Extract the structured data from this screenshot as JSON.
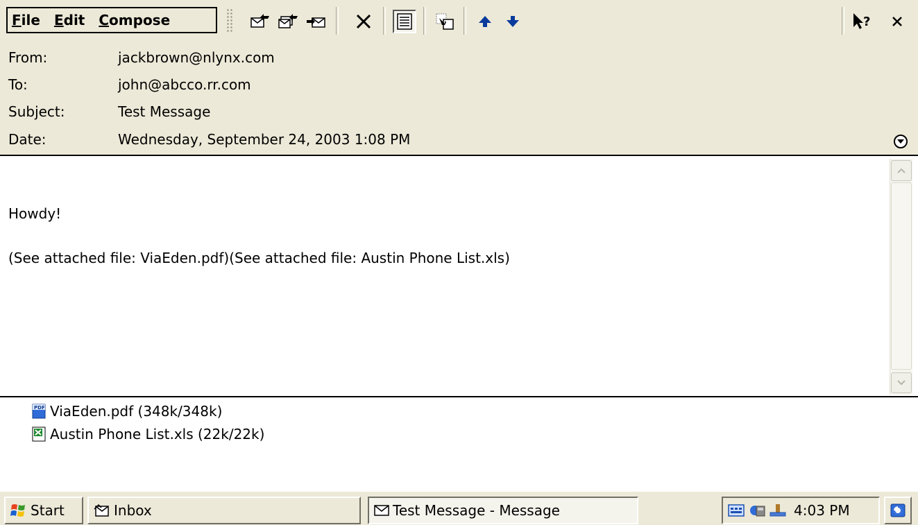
{
  "menu": {
    "file": {
      "mnemonic": "F",
      "rest": "ile"
    },
    "edit": {
      "mnemonic": "E",
      "rest": "dit"
    },
    "compose": {
      "mnemonic": "C",
      "rest": "ompose"
    }
  },
  "toolbar": {
    "icons": [
      "reply-icon",
      "reply-all-icon",
      "forward-icon",
      "delete-icon",
      "full-screen-icon",
      "move-icon",
      "previous-icon",
      "next-icon",
      "help-icon",
      "close-icon"
    ]
  },
  "header": {
    "from": {
      "label": "From:",
      "value": "jackbrown@nlynx.com"
    },
    "to": {
      "label": "To:",
      "value": "john@abcco.rr.com"
    },
    "subject": {
      "label": "Subject:",
      "value": "Test Message"
    },
    "date": {
      "label": "Date:",
      "value": "Wednesday, September 24, 2003 1:08 PM"
    }
  },
  "body": {
    "greeting": "Howdy!",
    "attachment_note": "(See attached file: ViaEden.pdf)(See attached file: Austin Phone List.xls)"
  },
  "attachments": [
    {
      "name": "ViaEden.pdf (348k/348k)",
      "icon": "pdf-file-icon"
    },
    {
      "name": "Austin Phone List.xls (22k/22k)",
      "icon": "excel-file-icon"
    }
  ],
  "taskbar": {
    "start_label": "Start",
    "inbox_label": "Inbox",
    "active_window_label": "Test Message - Message",
    "clock": "4:03 PM"
  },
  "colors": {
    "chrome": "#ECE9D8",
    "window_bg": "#FFFFFF",
    "toolbar_arrow_blue": "#0a3b9c"
  }
}
